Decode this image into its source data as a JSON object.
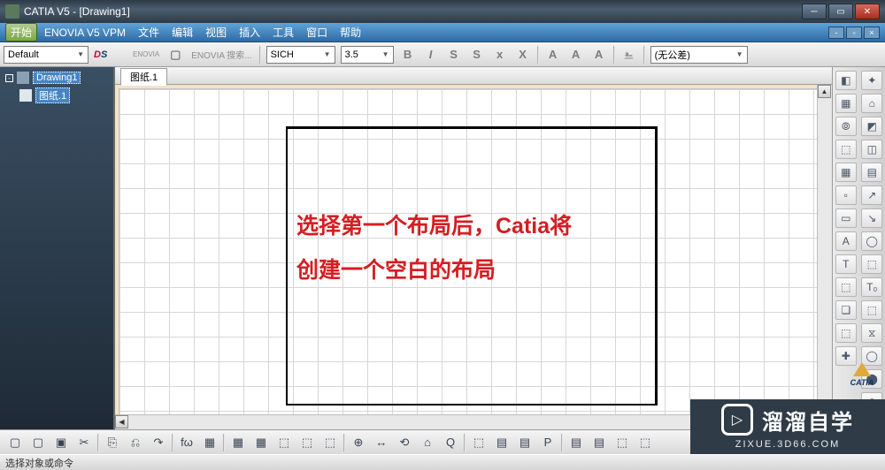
{
  "window": {
    "title": "CATIA V5 - [Drawing1]"
  },
  "menus": {
    "start": "开始",
    "enovia": "ENOVIA V5 VPM",
    "file": "文件",
    "edit": "编辑",
    "view": "视图",
    "insert": "插入",
    "tools": "工具",
    "window": "窗口",
    "help": "帮助"
  },
  "toolbar": {
    "style_select": "Default",
    "enovia_hint": "ENOVIA 搜索...",
    "font_select": "SICH",
    "size_select": "3.5",
    "tolerance": "(无公差)",
    "btn": {
      "B": "B",
      "I": "I",
      "S": "S",
      "S2": "S",
      "x2": "x",
      "x3": "X",
      "A1": "A",
      "A2": "A",
      "A3": "A"
    }
  },
  "tree": {
    "root": "Drawing1",
    "sheet": "图纸.1"
  },
  "sheet_tab": "图纸.1",
  "annotation": {
    "line1": "选择第一个布局后，Catia将",
    "line2": "创建一个空白的布局"
  },
  "status": "选择对象或命令",
  "brand": {
    "name": "溜溜自学",
    "sub": "ZIXUE.3D66.COM"
  },
  "catia_logo": "CATIA",
  "right_tools": {
    "c1": [
      "◧",
      "▦",
      "⦾",
      "⬚",
      "▦",
      "▫",
      "▭",
      "A",
      "T",
      "⬚",
      "❏",
      "⬚",
      "✚"
    ],
    "c2": [
      "✦",
      "⌂",
      "◩",
      "◫",
      "▤",
      "↗",
      "↘",
      "◯",
      "⬚",
      "T₀",
      "⬚",
      "⧖",
      "◯",
      "⬤",
      "⊕"
    ]
  },
  "bottom_tools": [
    "▢",
    "▢",
    "▣",
    "✂",
    "⎘",
    "⎌",
    "↷",
    "fω",
    "▦",
    "▦",
    "▦",
    "⬚",
    "⬚",
    "⬚",
    "⊕",
    "↔",
    "⟲",
    "⌂",
    "Q",
    "⬚",
    "▤",
    "▤",
    "P",
    "▤",
    "▤",
    "⬚",
    "⬚"
  ]
}
